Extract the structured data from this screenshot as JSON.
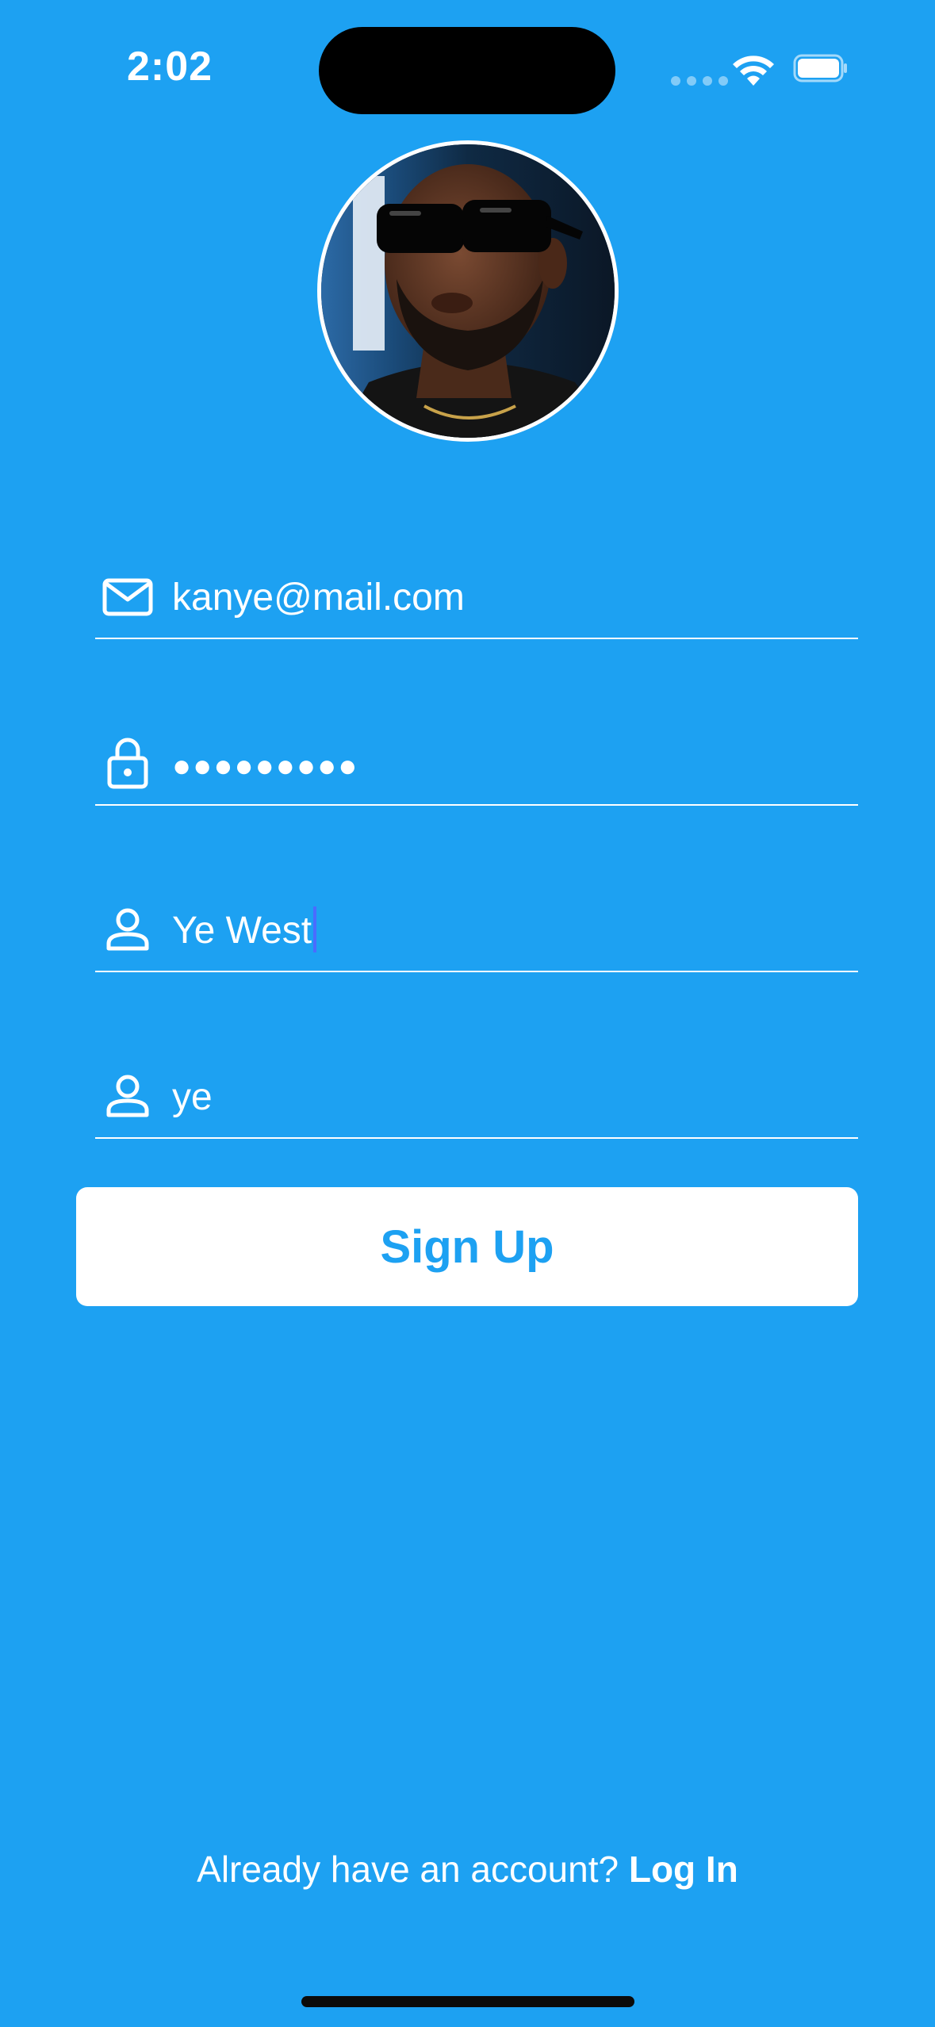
{
  "status_bar": {
    "time": "2:02"
  },
  "form": {
    "email_value": "kanye@mail.com",
    "password_value": "●●●●●●●●●",
    "fullname_value": "Ye West",
    "username_value": "ye"
  },
  "signup_button": {
    "label": "Sign Up"
  },
  "footer": {
    "prompt": "Already have an account?",
    "login_label": "Log In"
  },
  "icons": {
    "email": "envelope-icon",
    "password": "lock-icon",
    "fullname": "person-icon",
    "username": "person-icon"
  },
  "colors": {
    "background": "#1DA1F2",
    "button_background": "#FFFFFF",
    "button_text": "#1DA1F2",
    "text": "#FFFFFF"
  }
}
